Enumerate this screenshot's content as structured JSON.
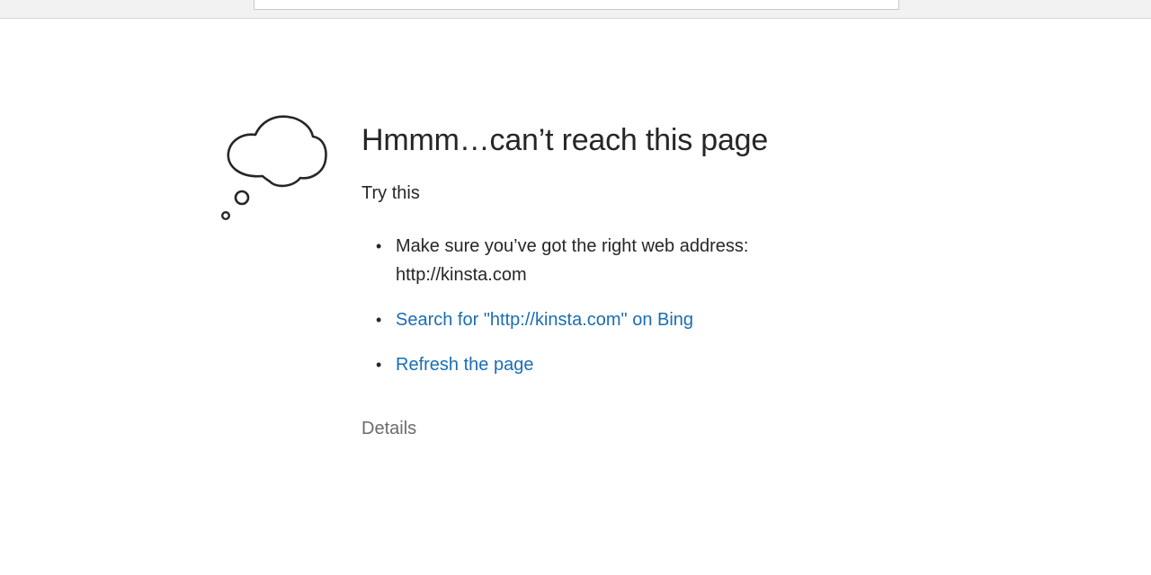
{
  "error": {
    "title": "Hmmm…can’t reach this page",
    "try_this": "Try this",
    "suggestions": [
      {
        "text": "Make sure you’ve got the right web address: http://kinsta.com"
      },
      {
        "text": "Search for \"http://kinsta.com\" on Bing"
      },
      {
        "text": "Refresh the page"
      }
    ],
    "details": "Details",
    "bullet": "•"
  },
  "colors": {
    "link": "#1a6db5",
    "text": "#262626",
    "muted": "#6b6b6b"
  },
  "icons": {
    "cloud": "thought-cloud-icon"
  }
}
